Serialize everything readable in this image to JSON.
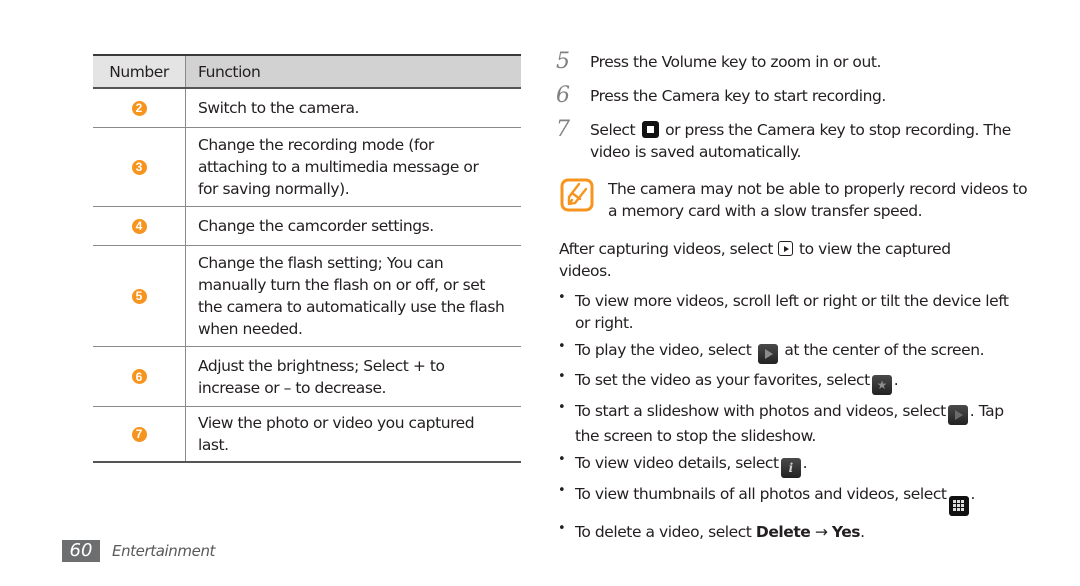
{
  "table": {
    "headers": {
      "number": "Number",
      "function": "Function"
    },
    "rows": [
      {
        "number": "2",
        "function": "Switch to the camera."
      },
      {
        "number": "3",
        "function": "Change the recording mode (for attaching to a multimedia message or for saving normally)."
      },
      {
        "number": "4",
        "function": "Change the camcorder settings."
      },
      {
        "number": "5",
        "function": "Change the flash setting; You can manually turn the flash on or off, or set the camera to automatically use the flash when needed."
      },
      {
        "number": "6",
        "function": "Adjust the brightness; Select + to increase or – to decrease."
      },
      {
        "number": "7",
        "function": "View the photo or video you captured last."
      }
    ],
    "badge_color": "#f7941d"
  },
  "steps": [
    {
      "number": "5",
      "text": "Press the Volume key to zoom in or out."
    },
    {
      "number": "6",
      "text": "Press the Camera key to start recording."
    },
    {
      "number": "7",
      "pre": "Select",
      "icon": "stop-icon",
      "post": "or press the Camera key to stop recording. The video is saved automatically."
    }
  ],
  "note": {
    "icon": "note-pencil-icon",
    "text": "The camera may not be able to properly record videos to a memory card with a slow transfer speed."
  },
  "after_capture": {
    "pre": "After capturing videos, select",
    "icon": "play-outline-icon",
    "post": "to view the captured videos."
  },
  "bullets": [
    {
      "text": "To view more videos, scroll left or right or tilt the device left or right."
    },
    {
      "pre": "To play the video, select",
      "icon": "play-icon",
      "post": "at the center of the screen."
    },
    {
      "pre": "To set the video as your favorites, select",
      "icon": "star-icon",
      "post": "."
    },
    {
      "pre": "To start a slideshow with photos and videos, select",
      "icon": "slideshow-icon",
      "post": ". Tap the screen to stop the slideshow."
    },
    {
      "pre": "To view video details, select",
      "icon": "info-icon",
      "post": "."
    },
    {
      "pre": "To view thumbnails of all photos and videos, select",
      "icon": "grid-icon",
      "post": "."
    },
    {
      "pre": "To delete a video, select",
      "bold1": "Delete",
      "arrow": "→",
      "bold2": "Yes",
      "post": "."
    }
  ],
  "footer": {
    "page_number": "60",
    "section": "Entertainment"
  }
}
